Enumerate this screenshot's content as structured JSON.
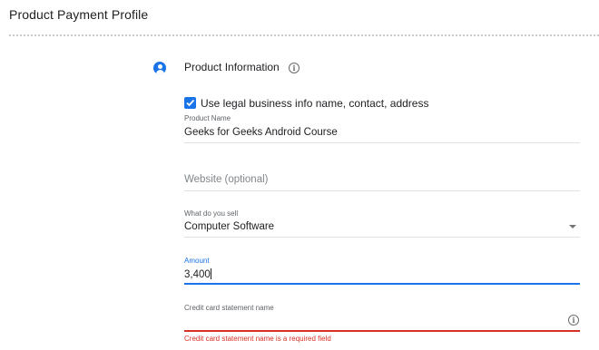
{
  "header": {
    "title": "Product Payment Profile"
  },
  "section": {
    "icon": "account-circle-icon",
    "title": "Product Information",
    "info_icon": "info-icon"
  },
  "checkbox": {
    "checked": true,
    "label": "Use legal business info name, contact, address"
  },
  "fields": {
    "product_name": {
      "label": "Product Name",
      "value": "Geeks for Geeks Android Course"
    },
    "website": {
      "placeholder": "Website (optional)"
    },
    "what_you_sell": {
      "label": "What do you sell",
      "value": "Computer Software"
    },
    "amount": {
      "label": "Amount",
      "value": "3,400"
    },
    "statement_name": {
      "label": "Credit card statement name",
      "value": "",
      "error": "Credit card statement name is a required field"
    }
  },
  "colors": {
    "accent": "#1a73e8",
    "error": "#d93025"
  }
}
